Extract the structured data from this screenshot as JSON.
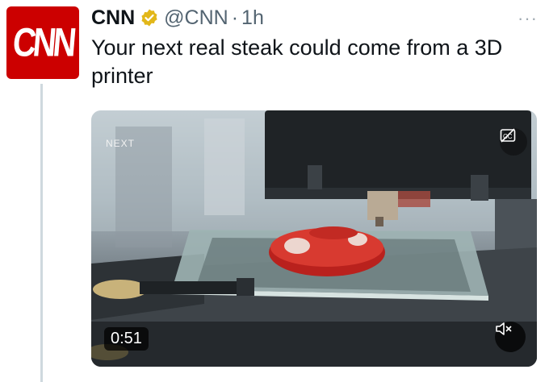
{
  "avatar": {
    "logo_text": "CNN",
    "color": "#cc0000"
  },
  "header": {
    "name": "CNN",
    "handle": "@CNN",
    "separator": "·",
    "time": "1h",
    "more": "···"
  },
  "tweet": {
    "text": "Your next real steak could come from a 3D printer"
  },
  "media": {
    "type": "video",
    "overlay_label": "NEXT",
    "duration": "0:51",
    "captions_icon": "closed-captions-off-icon",
    "volume_icon": "muted-speaker-icon"
  },
  "colors": {
    "verified_badge": "#e2b719",
    "secondary_text": "#536471",
    "thread_line": "#cfd9de"
  }
}
